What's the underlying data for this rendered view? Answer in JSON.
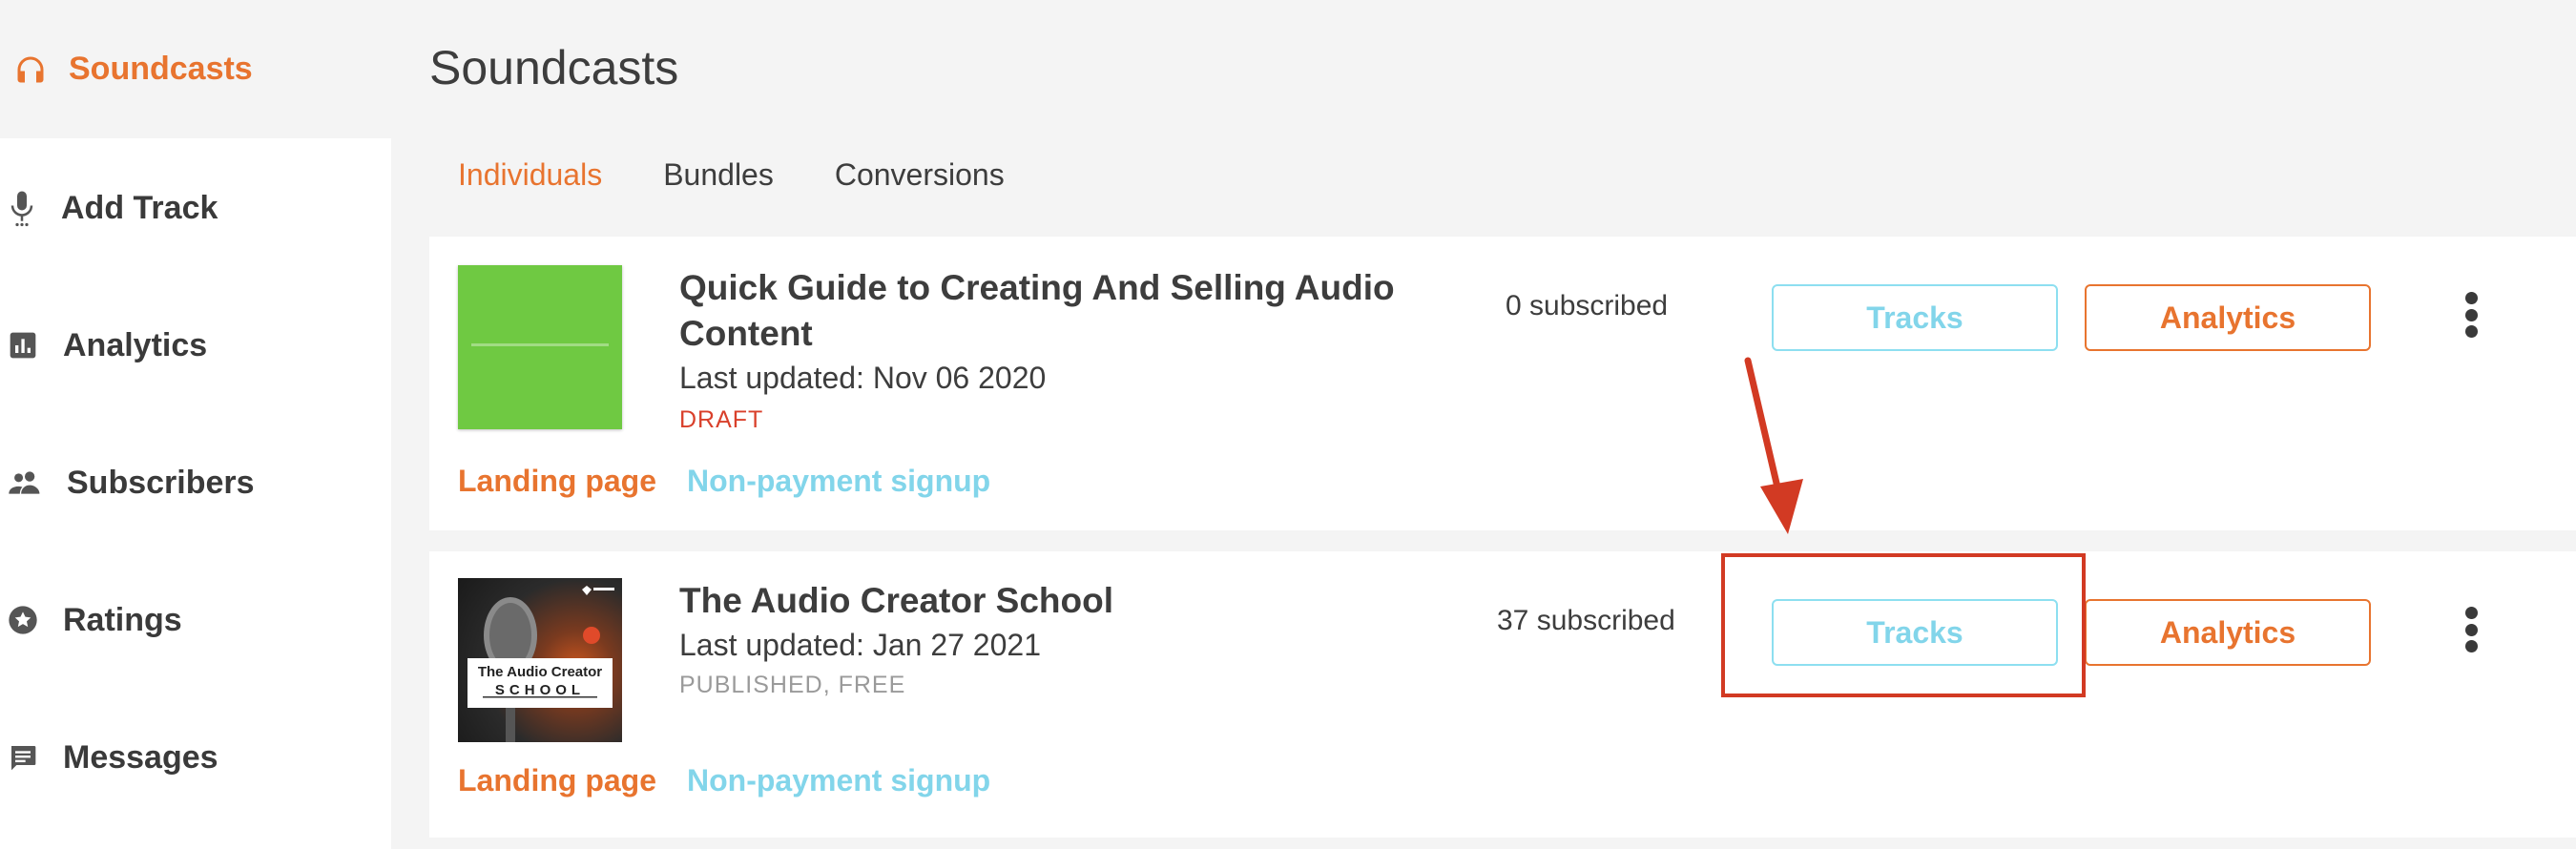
{
  "sidebar": {
    "brand": {
      "label": "Soundcasts",
      "icon": "headphones-icon"
    },
    "items": [
      {
        "label": "Add Track",
        "icon": "microphone-icon"
      },
      {
        "label": "Analytics",
        "icon": "bar-chart-icon"
      },
      {
        "label": "Subscribers",
        "icon": "people-icon"
      },
      {
        "label": "Ratings",
        "icon": "star-icon"
      },
      {
        "label": "Messages",
        "icon": "message-icon"
      }
    ]
  },
  "main": {
    "title": "Soundcasts",
    "tabs": [
      {
        "label": "Individuals",
        "active": true
      },
      {
        "label": "Bundles",
        "active": false
      },
      {
        "label": "Conversions",
        "active": false
      }
    ],
    "soundcasts": [
      {
        "title": "Quick Guide to Creating And Selling Audio Content",
        "last_updated": "Last updated: Nov 06 2020",
        "status": "DRAFT",
        "subscribed": "0 subscribed",
        "tracks_label": "Tracks",
        "analytics_label": "Analytics",
        "landing_label": "Landing page",
        "nonpayment_label": "Non-payment signup"
      },
      {
        "title": "The Audio Creator School",
        "last_updated": "Last updated: Jan 27 2021",
        "status": "PUBLISHED, FREE",
        "subscribed": "37 subscribed",
        "tracks_label": "Tracks",
        "analytics_label": "Analytics",
        "landing_label": "Landing page",
        "nonpayment_label": "Non-payment signup",
        "cover_text_line1": "The Audio Creator",
        "cover_text_line2": "SCHOOL"
      }
    ]
  },
  "colors": {
    "accent": "#e8742f",
    "secondary": "#82d5ea",
    "draft": "#d9402b",
    "annotation": "#d23a23"
  }
}
